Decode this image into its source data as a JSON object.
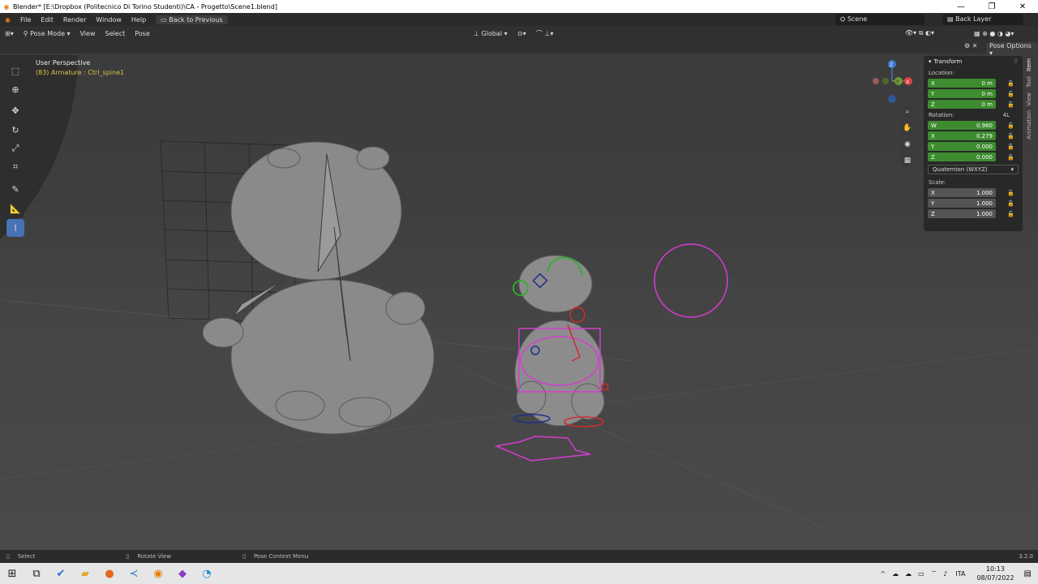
{
  "window": {
    "title": "Blender* [E:\\Dropbox (Politecnico Di Torino Studenti)\\CA - Progetto\\Scene1.blend]",
    "controls": [
      "—",
      "❐",
      "✕"
    ]
  },
  "menu": {
    "items": [
      "File",
      "Edit",
      "Render",
      "Window",
      "Help"
    ],
    "back_button": "Back to Previous",
    "scene_label": "Scene",
    "layer_label": "Back Layer"
  },
  "viewport_header": {
    "mode": "Pose Mode",
    "menus": [
      "View",
      "Select",
      "Pose"
    ],
    "orientation": "Global",
    "pose_options": "Pose Options"
  },
  "viewport": {
    "perspective_label": "User Perspective",
    "object_label": "(83) Armature : Ctrl_spine1"
  },
  "tools": [
    {
      "name": "select-box-tool",
      "glyph": "⬚"
    },
    {
      "name": "cursor-tool",
      "glyph": "⊕"
    },
    {
      "name": "move-tool",
      "glyph": "✥"
    },
    {
      "name": "rotate-tool",
      "glyph": "↻"
    },
    {
      "name": "scale-tool",
      "glyph": "⤢"
    },
    {
      "name": "transform-tool",
      "glyph": "⌗"
    },
    {
      "name": "annotate-tool",
      "glyph": "✎"
    },
    {
      "name": "measure-tool",
      "glyph": "📐"
    },
    {
      "name": "pose-tool",
      "glyph": "⌇"
    }
  ],
  "transform_panel": {
    "header": "Transform",
    "location_label": "Location:",
    "location": [
      {
        "axis": "X",
        "value": "0 m"
      },
      {
        "axis": "Y",
        "value": "0 m"
      },
      {
        "axis": "Z",
        "value": "0 m"
      }
    ],
    "rotation_label": "Rotation:",
    "rotation_mode_flag": "4L",
    "rotation": [
      {
        "axis": "W",
        "value": "0.960"
      },
      {
        "axis": "X",
        "value": "0.279"
      },
      {
        "axis": "Y",
        "value": "0.000"
      },
      {
        "axis": "Z",
        "value": "0.000"
      }
    ],
    "rotation_mode": "Quaternion (WXYZ)",
    "scale_label": "Scale:",
    "scale": [
      {
        "axis": "X",
        "value": "1.000"
      },
      {
        "axis": "Y",
        "value": "1.000"
      },
      {
        "axis": "Z",
        "value": "1.000"
      }
    ]
  },
  "side_tabs": [
    "Item",
    "Tool",
    "View",
    "Animation"
  ],
  "status_bar": {
    "select": "Select",
    "rotate": "Rotate View",
    "context": "Pose Context Menu",
    "version": "3.2.0"
  },
  "taskbar": {
    "language": "ITA",
    "time": "10:13",
    "date": "08/07/2022"
  },
  "gizmo": {
    "z": "Z",
    "y": "Y",
    "x": "X"
  },
  "colors": {
    "accent": "#4772b3",
    "field_green": "#3d8c2f",
    "bone_magenta": "#d63cd0",
    "bone_green": "#2fb02f",
    "bone_red": "#d42a2a",
    "bone_blue": "#1d2f8c"
  }
}
